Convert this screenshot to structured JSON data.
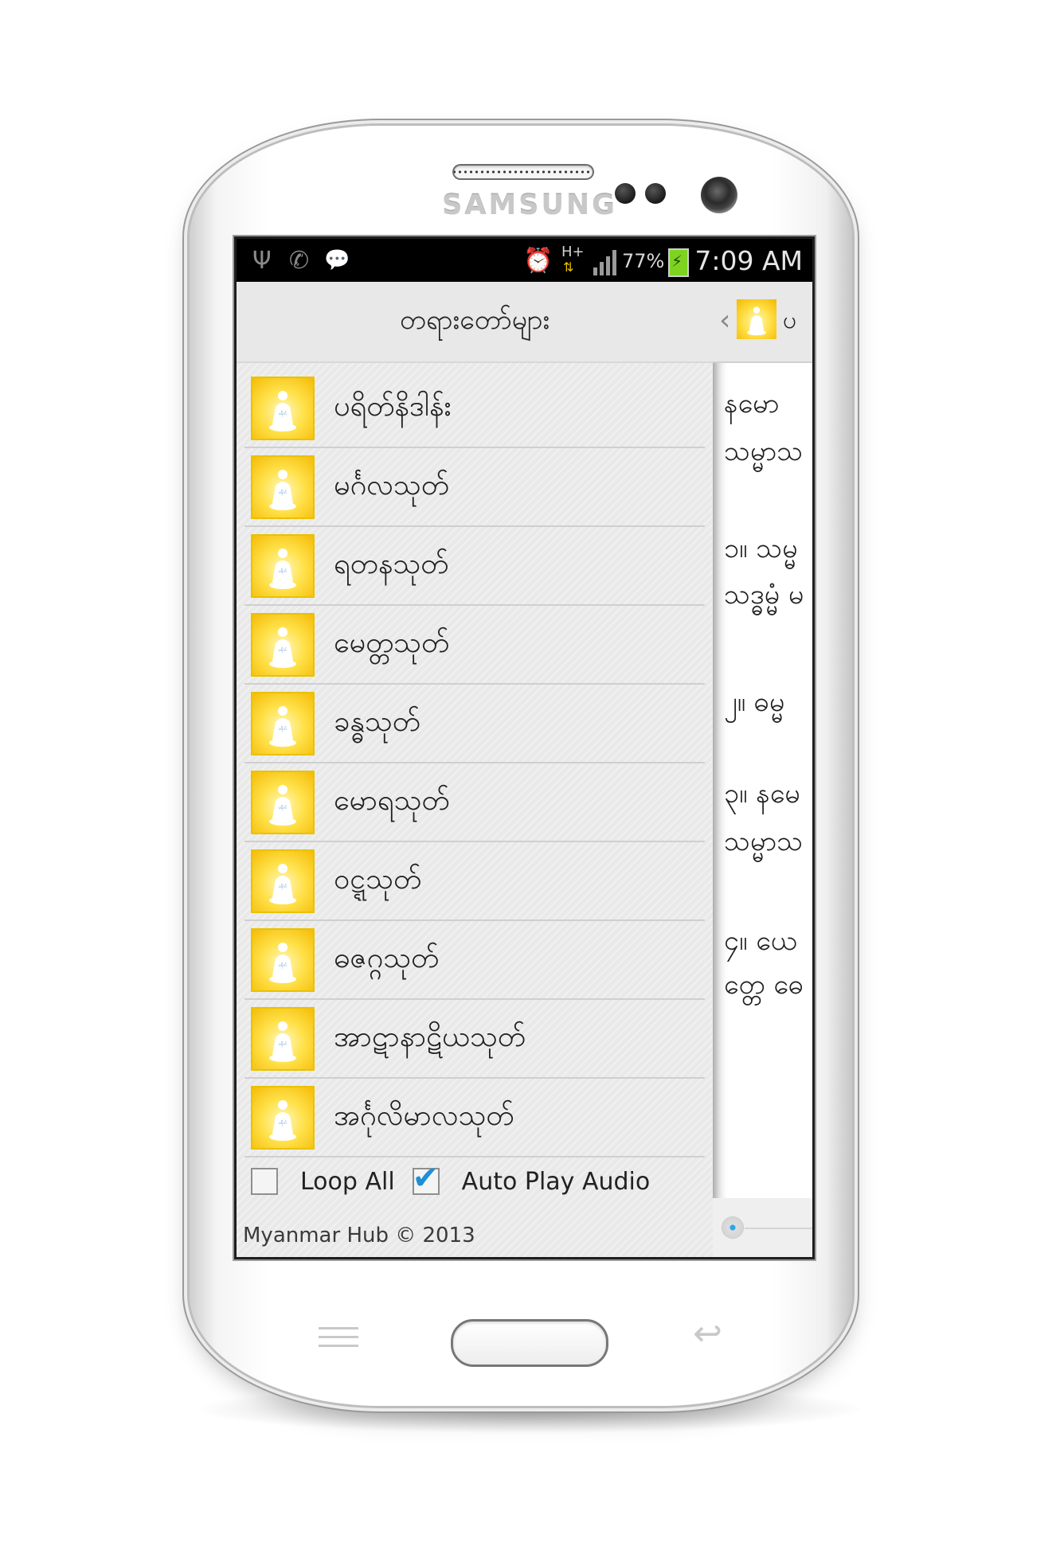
{
  "device": {
    "brand": "SAMSUNG"
  },
  "statusbar": {
    "left_icons": [
      "usb-icon",
      "missed-call-icon",
      "message-icon"
    ],
    "right_icons": [
      "alarm-icon",
      "hspa-plus-icon",
      "signal-icon",
      "battery-charging-icon"
    ],
    "network": "H+",
    "battery_percent": "77%",
    "time": "7:09 AM",
    "battery_color": "#7ed321"
  },
  "drawer": {
    "title": "တရားတော်များ",
    "items": [
      {
        "label": "ပရိတ်နိဒါန်း",
        "icon": "buddha-icon"
      },
      {
        "label": "မင်္ဂလသုတ်",
        "icon": "buddha-icon"
      },
      {
        "label": "ရတနသုတ်",
        "icon": "buddha-icon"
      },
      {
        "label": "မေတ္တသုတ်",
        "icon": "buddha-icon"
      },
      {
        "label": "ခန္ဓသုတ်",
        "icon": "buddha-icon"
      },
      {
        "label": "မောရသုတ်",
        "icon": "buddha-icon"
      },
      {
        "label": "ဝဋ္ဋသုတ်",
        "icon": "buddha-icon"
      },
      {
        "label": "ဓဇဂ္ဂသုတ်",
        "icon": "buddha-icon"
      },
      {
        "label": "အာဋာနာဋိယသုတ်",
        "icon": "buddha-icon"
      },
      {
        "label": "အင်္ဂုလိမာလသုတ်",
        "icon": "buddha-icon"
      }
    ],
    "options": {
      "loop_all": {
        "label": "Loop All",
        "checked": false
      },
      "auto_play": {
        "label": "Auto Play Audio",
        "checked": true
      }
    },
    "footer": "Myanmar Hub © 2013"
  },
  "content": {
    "title": "ပ",
    "lines": [
      "နမော ",
      "သမ္မာသ",
      "၁။ သမ္မ",
      "သဒ္ဓမ္မံ မ",
      "၂။ ဓမ္မ",
      "၃။ နမေ",
      "သမ္မာသ",
      "၄။ ယေ",
      "တ္တေ ဓေ"
    ],
    "accent_color": "#2aa6e8"
  }
}
